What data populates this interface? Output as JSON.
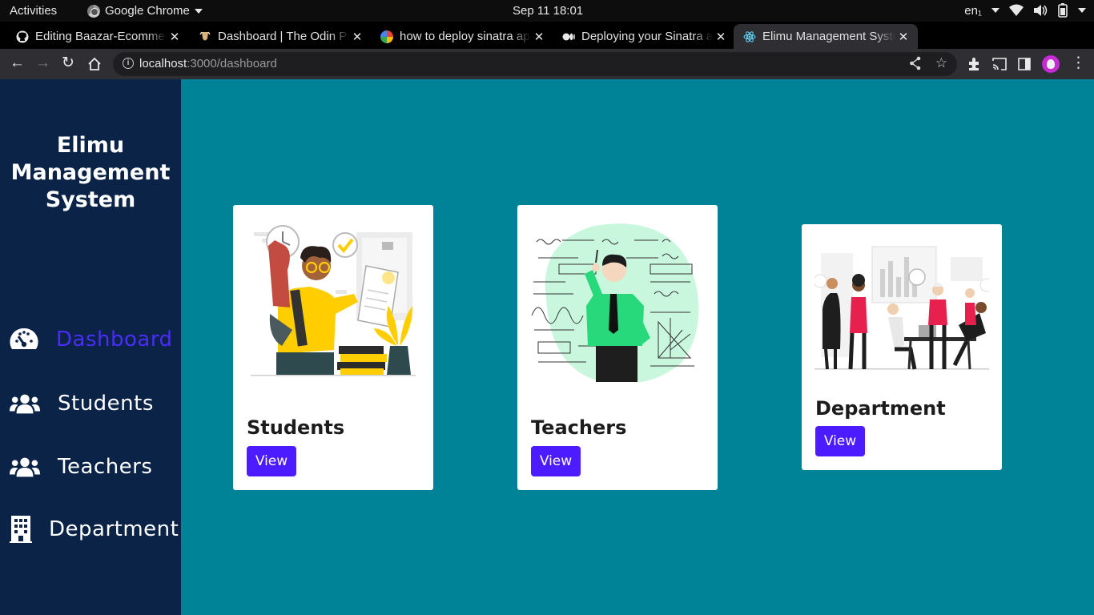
{
  "os_bar": {
    "activities": "Activities",
    "app_name": "Google Chrome",
    "clock": "Sep 11  18:01",
    "lang": "en₁"
  },
  "browser": {
    "tabs": [
      {
        "title": "Editing Baazar-Ecommerce",
        "icon": "github-icon"
      },
      {
        "title": "Dashboard | The Odin Project",
        "icon": "odin-icon"
      },
      {
        "title": "how to deploy sinatra app",
        "icon": "google-icon"
      },
      {
        "title": "Deploying your Sinatra app",
        "icon": "medium-icon"
      },
      {
        "title": "Elimu Management System",
        "icon": "react-icon",
        "active": true
      }
    ],
    "url_host": "localhost",
    "url_path": ":3000/dashboard"
  },
  "sidebar": {
    "brand": [
      "Elimu",
      "Management",
      "System"
    ],
    "items": [
      {
        "label": "Dashboard",
        "icon": "gauge-icon",
        "active": true
      },
      {
        "label": "Students",
        "icon": "users-icon"
      },
      {
        "label": "Teachers",
        "icon": "users-icon"
      },
      {
        "label": "Department",
        "icon": "building-icon"
      }
    ]
  },
  "cards": [
    {
      "title": "Students",
      "button": "View",
      "image": "student-illustration"
    },
    {
      "title": "Teachers",
      "button": "View",
      "image": "teacher-illustration"
    },
    {
      "title": "Department",
      "button": "View",
      "image": "department-illustration"
    }
  ],
  "colors": {
    "sidebar_bg": "#0a2346",
    "main_bg": "#008396",
    "accent": "#4d1bff",
    "active_nav": "#4b2cff"
  }
}
